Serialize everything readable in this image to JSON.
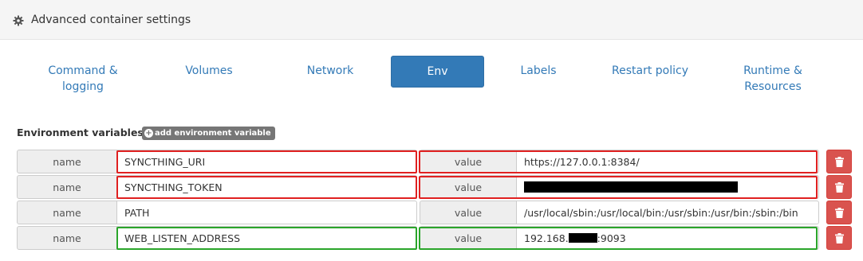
{
  "header": {
    "title": "Advanced container settings",
    "icon": "gear-icon"
  },
  "tabs": [
    {
      "label": "Command &\nlogging"
    },
    {
      "label": "Volumes"
    },
    {
      "label": "Network"
    },
    {
      "label": "Env",
      "active": true
    },
    {
      "label": "Labels"
    },
    {
      "label": "Restart policy"
    },
    {
      "label": "Runtime &\nResources"
    }
  ],
  "env": {
    "section_label": "Environment variables",
    "add_button_label": "add environment variable",
    "name_addon": "name",
    "value_addon": "value",
    "rows": [
      {
        "name": "SYNCTHING_URI",
        "value": "https://127.0.0.1:8384/",
        "highlight": "red"
      },
      {
        "name": "SYNCTHING_TOKEN",
        "value": "",
        "value_redacted": true,
        "highlight": "red"
      },
      {
        "name": "PATH",
        "value": "/usr/local/sbin:/usr/local/bin:/usr/sbin:/usr/bin:/sbin:/bin"
      },
      {
        "name": "WEB_LISTEN_ADDRESS",
        "value_prefix": "192.168.",
        "value_suffix": ":9093",
        "value_partially_redacted": true,
        "highlight": "green"
      }
    ]
  },
  "colors": {
    "accent": "#337ab7",
    "danger": "#d9534f",
    "highlight_red": "#e02020",
    "highlight_green": "#2aa52a"
  }
}
